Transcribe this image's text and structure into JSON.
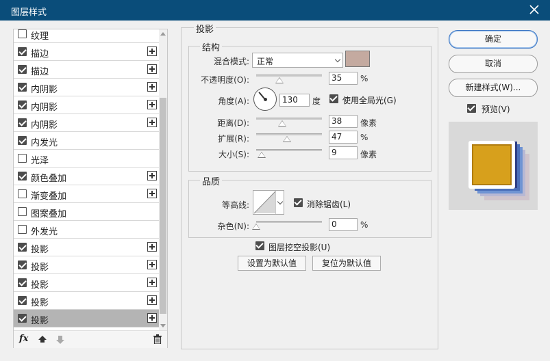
{
  "window": {
    "title": "图层样式"
  },
  "style_list": [
    {
      "label": "纹理",
      "checked": false,
      "has_add": false,
      "selected": false
    },
    {
      "label": "描边",
      "checked": true,
      "has_add": true,
      "selected": false
    },
    {
      "label": "描边",
      "checked": true,
      "has_add": true,
      "selected": false
    },
    {
      "label": "内阴影",
      "checked": true,
      "has_add": true,
      "selected": false
    },
    {
      "label": "内阴影",
      "checked": true,
      "has_add": true,
      "selected": false
    },
    {
      "label": "内阴影",
      "checked": true,
      "has_add": true,
      "selected": false
    },
    {
      "label": "内发光",
      "checked": true,
      "has_add": false,
      "selected": false
    },
    {
      "label": "光泽",
      "checked": false,
      "has_add": false,
      "selected": false
    },
    {
      "label": "颜色叠加",
      "checked": true,
      "has_add": true,
      "selected": false
    },
    {
      "label": "渐变叠加",
      "checked": false,
      "has_add": true,
      "selected": false
    },
    {
      "label": "图案叠加",
      "checked": false,
      "has_add": false,
      "selected": false
    },
    {
      "label": "外发光",
      "checked": false,
      "has_add": false,
      "selected": false
    },
    {
      "label": "投影",
      "checked": true,
      "has_add": true,
      "selected": false
    },
    {
      "label": "投影",
      "checked": true,
      "has_add": true,
      "selected": false
    },
    {
      "label": "投影",
      "checked": true,
      "has_add": true,
      "selected": false
    },
    {
      "label": "投影",
      "checked": true,
      "has_add": true,
      "selected": false
    },
    {
      "label": "投影",
      "checked": true,
      "has_add": true,
      "selected": true
    }
  ],
  "list_toolbar": {
    "fx_label": "fx"
  },
  "drop_shadow": {
    "section_title": "投影",
    "structure": {
      "title": "结构",
      "blend_mode_label": "混合模式:",
      "blend_mode_value": "正常",
      "shadow_color": "#c4aaa0",
      "opacity_label": "不透明度(O):",
      "opacity_value": "35",
      "opacity_unit": "%",
      "angle_label": "角度(A):",
      "angle_value": "130",
      "angle_unit": "度",
      "global_light_label": "使用全局光(G)",
      "global_light_checked": true,
      "distance_label": "距离(D):",
      "distance_value": "38",
      "distance_unit": "像素",
      "spread_label": "扩展(R):",
      "spread_value": "47",
      "spread_unit": "%",
      "size_label": "大小(S):",
      "size_value": "9",
      "size_unit": "像素"
    },
    "quality": {
      "title": "品质",
      "contour_label": "等高线:",
      "anti_alias_label": "消除锯齿(L)",
      "anti_alias_checked": true,
      "noise_label": "杂色(N):",
      "noise_value": "0",
      "noise_unit": "%"
    },
    "knockout_label": "图层挖空投影(U)",
    "knockout_checked": true,
    "make_default_label": "设置为默认值",
    "reset_default_label": "复位为默认值"
  },
  "right_panel": {
    "ok_label": "确定",
    "cancel_label": "取消",
    "new_style_label": "新建样式(W)...",
    "preview_label": "预览(V)",
    "preview_checked": true
  }
}
